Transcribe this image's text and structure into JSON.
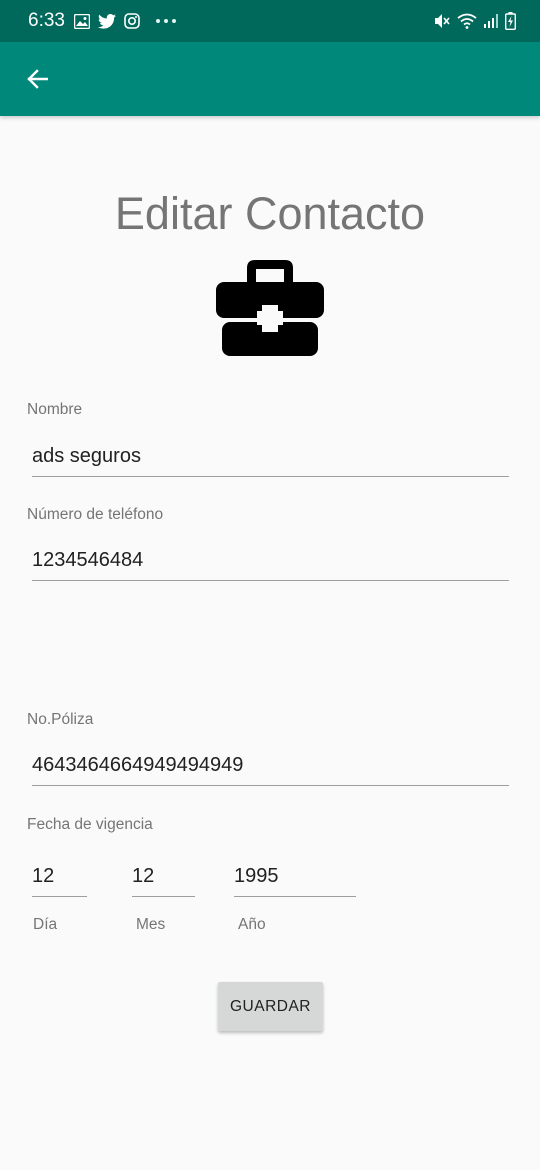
{
  "status_bar": {
    "time": "6:33",
    "left_icons": [
      "gallery-icon",
      "twitter-icon",
      "instagram-icon",
      "more-dots-icon"
    ],
    "right_icons": [
      "mute-icon",
      "wifi-icon",
      "signal-icon",
      "battery-charging-icon"
    ]
  },
  "app_bar": {
    "background": "#00897b",
    "status_background": "#00695c",
    "back_icon": "arrow-back-icon"
  },
  "page": {
    "title": "Editar Contacto",
    "icon": "briefcase-medical-icon"
  },
  "form": {
    "name_label": "Nombre",
    "name_value": "ads seguros",
    "phone_label": "Número de teléfono",
    "phone_value": "1234546484",
    "policy_label": "No.Póliza",
    "policy_value": "4643464664949494949",
    "date_label": "Fecha de vigencia",
    "day_value": "12",
    "month_value": "12",
    "year_value": "1995",
    "day_label": "Día",
    "month_label": "Mes",
    "year_label": "Año"
  },
  "actions": {
    "save_label": "GUARDAR"
  }
}
